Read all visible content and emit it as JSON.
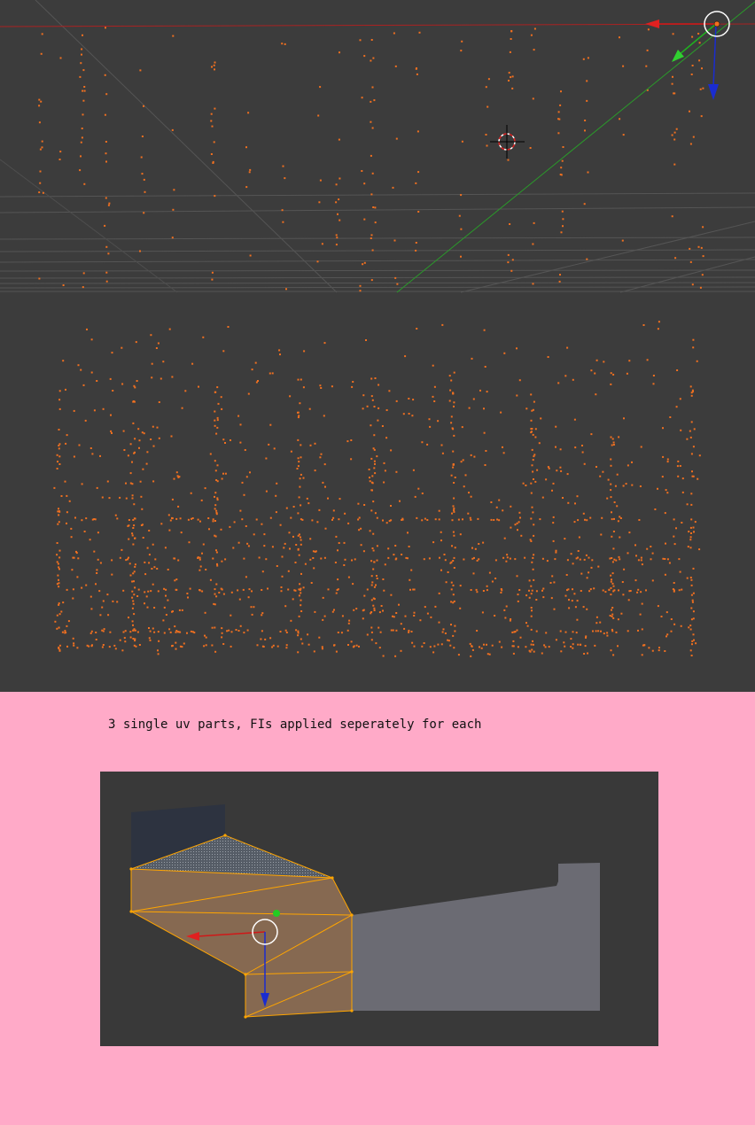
{
  "top_viewport": {
    "background_color": "#3c3c3c",
    "vertex_color": "#f07020",
    "axes": {
      "x_color": "#cc2222",
      "y_color": "#22aa22",
      "z_color": "#2233cc"
    }
  },
  "caption": {
    "text": "3 single uv parts, FIs applied seperately for each"
  },
  "bottom_viewport": {
    "background_color": "#393939",
    "selected_face_color": "#8a6c52",
    "edge_color": "#ffa500",
    "unselected_face_color": "#6b6b73",
    "dark_face_color": "#2d3340"
  },
  "page": {
    "background_color": "#ffaac8"
  }
}
